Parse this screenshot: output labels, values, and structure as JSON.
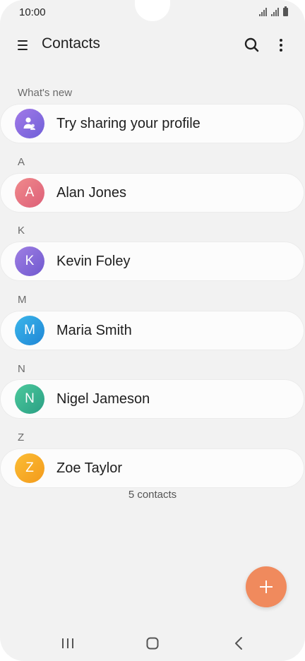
{
  "status_bar": {
    "time": "10:00"
  },
  "app_bar": {
    "title": "Contacts"
  },
  "whats_new": {
    "label": "What's new",
    "item": {
      "label": "Try sharing your profile",
      "icon": "profile-share-icon",
      "color": "#8e6be0"
    }
  },
  "groups": [
    {
      "letter": "A",
      "contact": {
        "initial": "A",
        "name": "Alan Jones",
        "color": "#e8707f"
      }
    },
    {
      "letter": "K",
      "contact": {
        "initial": "K",
        "name": "Kevin Foley",
        "color": "#8a68d8"
      }
    },
    {
      "letter": "M",
      "contact": {
        "initial": "M",
        "name": "Maria Smith",
        "color": "#2a9de0"
      }
    },
    {
      "letter": "N",
      "contact": {
        "initial": "N",
        "name": "Nigel Jameson",
        "color": "#3bb58e"
      }
    },
    {
      "letter": "Z",
      "contact": {
        "initial": "Z",
        "name": "Zoe Taylor",
        "color": "#f7a823"
      }
    }
  ],
  "footer": {
    "count_text": "5 contacts"
  },
  "fab": {
    "icon": "plus-icon",
    "color": "#f08a5d"
  },
  "nav_bar": {
    "icons": [
      "recent-apps-icon",
      "home-icon",
      "back-icon"
    ]
  }
}
